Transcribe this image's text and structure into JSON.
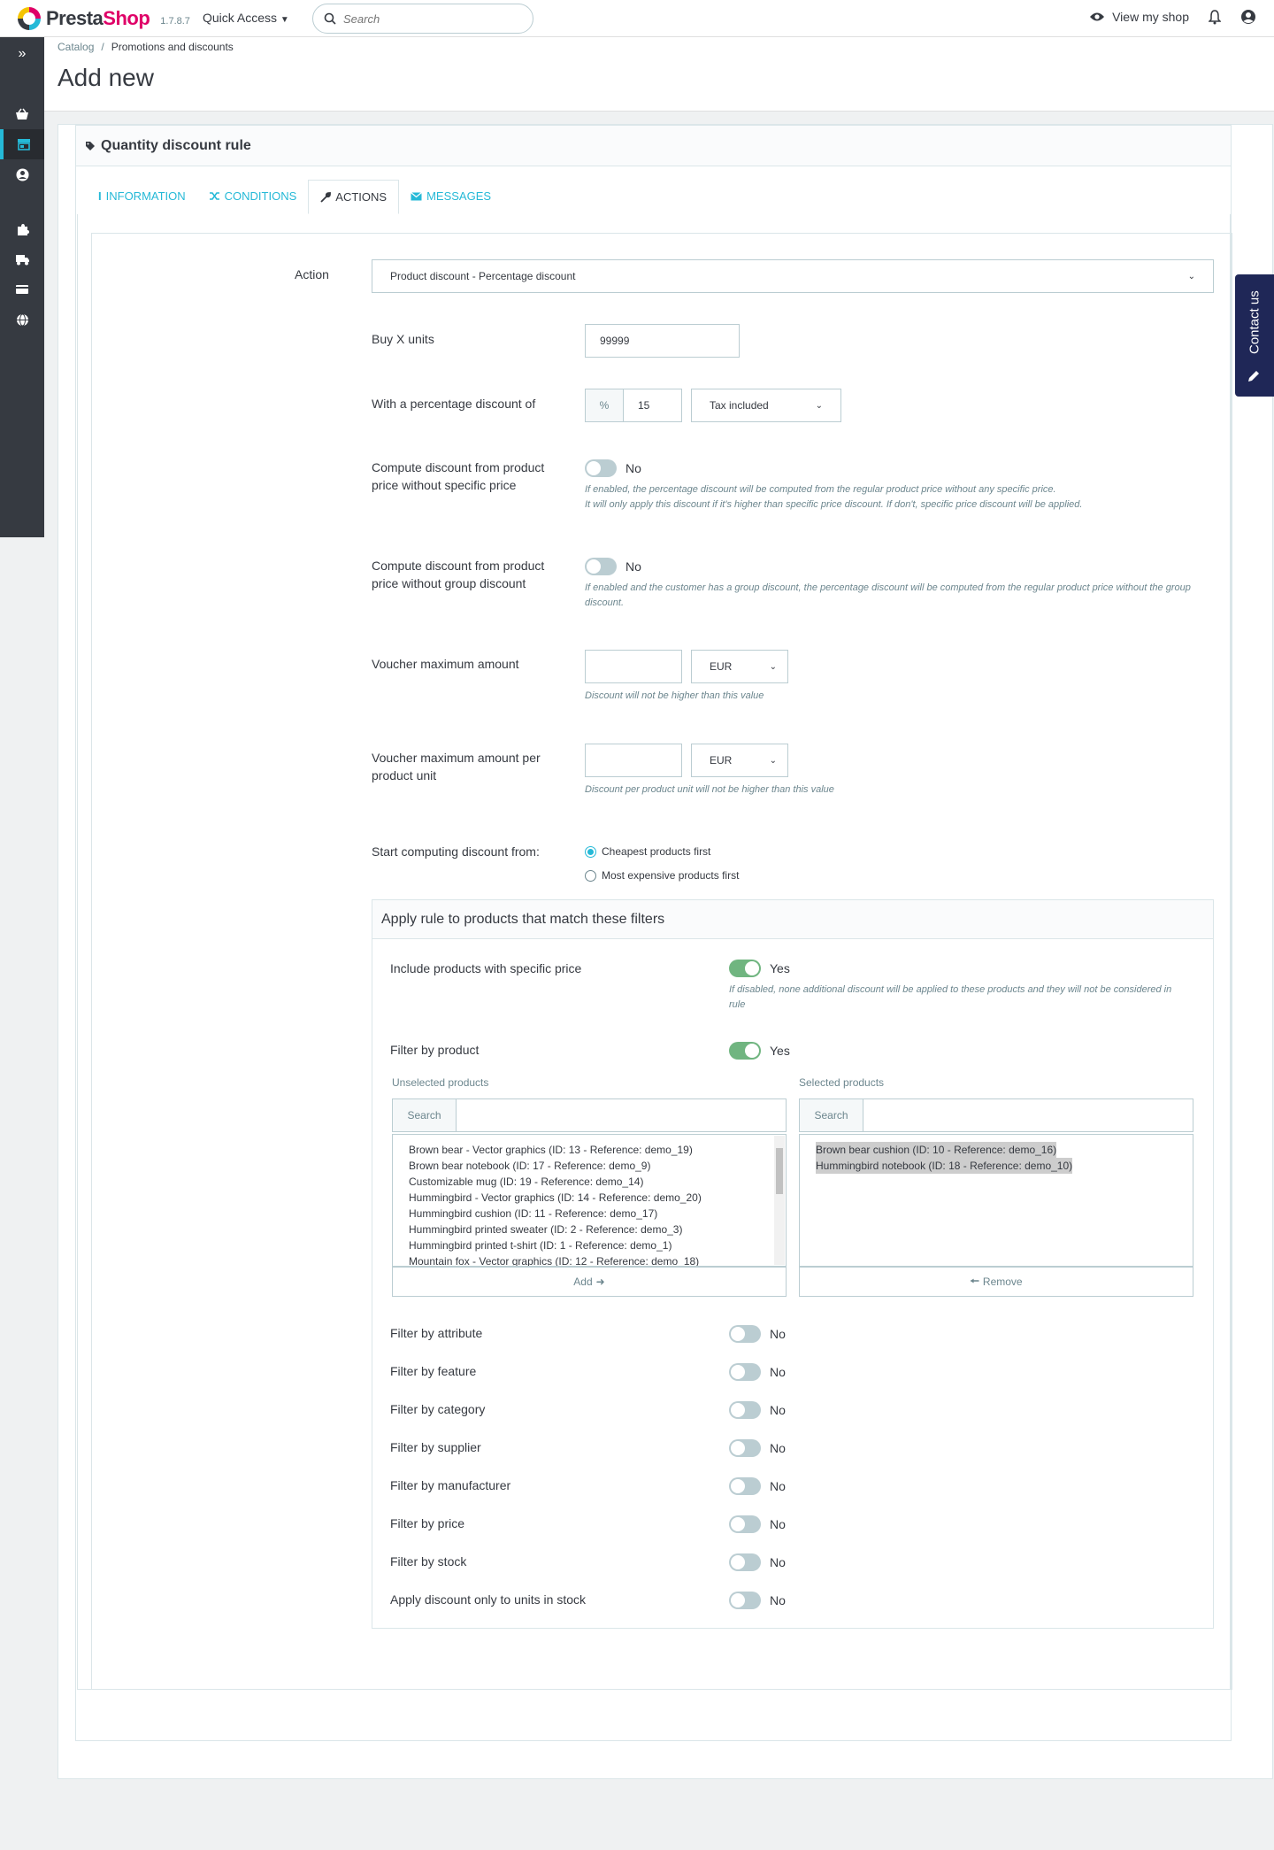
{
  "header": {
    "logo_presta": "Presta",
    "logo_shop": "Shop",
    "version": "1.7.8.7",
    "quick_access": "Quick Access",
    "search_placeholder": "Search",
    "view_my_shop": "View my shop"
  },
  "breadcrumb": {
    "catalog": "Catalog",
    "current": "Promotions and discounts"
  },
  "page_title": "Add new",
  "panel_title": "Quantity discount rule",
  "tabs": [
    {
      "label": "Information"
    },
    {
      "label": "Conditions"
    },
    {
      "label": "Actions"
    },
    {
      "label": "Messages"
    }
  ],
  "form": {
    "action_label": "Action",
    "action_value": "Product discount - Percentage discount",
    "buy_x_label": "Buy X units",
    "buy_x_value": "99999",
    "percent_label": "With a percentage discount of",
    "percent_addon": "%",
    "percent_value": "15",
    "tax_value": "Tax included",
    "compute_specific_label": "Compute discount from product price without specific price",
    "compute_specific_state": "No",
    "compute_specific_help_1": "If enabled, the percentage discount will be computed from the regular product price without any specific price.",
    "compute_specific_help_2": "It will only apply this discount if it's higher than specific price discount. If don't, specific price discount will be applied.",
    "compute_group_label": "Compute discount from product price without group discount",
    "compute_group_state": "No",
    "compute_group_help": "If enabled and the customer has a group discount, the percentage discount will be computed from the regular product price without the group discount.",
    "voucher_max_label": "Voucher maximum amount",
    "voucher_max_value": "",
    "voucher_max_currency": "EUR",
    "voucher_max_help": "Discount will not be higher than this value",
    "voucher_unit_label": "Voucher maximum amount per product unit",
    "voucher_unit_value": "",
    "voucher_unit_currency": "EUR",
    "voucher_unit_help": "Discount per product unit will not be higher than this value",
    "start_label": "Start computing discount from:",
    "start_opt_1": "Cheapest products first",
    "start_opt_2": "Most expensive products first"
  },
  "filters": {
    "title": "Apply rule to products that match these filters",
    "include_specific_label": "Include products with specific price",
    "include_specific_state": "Yes",
    "include_specific_help": "If disabled, none additional discount will be applied to these products and they will not be considered in rule",
    "filter_product_label": "Filter by product",
    "filter_product_state": "Yes",
    "unselected_label": "Unselected products",
    "selected_label": "Selected products",
    "search_addon": "Search",
    "unselected": [
      "Brown bear - Vector graphics (ID: 13 - Reference: demo_19)",
      "Brown bear notebook (ID: 17 - Reference: demo_9)",
      "Customizable mug (ID: 19 - Reference: demo_14)",
      "Hummingbird - Vector graphics (ID: 14 - Reference: demo_20)",
      "Hummingbird cushion (ID: 11 - Reference: demo_17)",
      "Hummingbird printed sweater (ID: 2 - Reference: demo_3)",
      "Hummingbird printed t-shirt (ID: 1 - Reference: demo_1)",
      "Mountain fox - Vector graphics (ID: 12 - Reference: demo_18)"
    ],
    "selected": [
      "Brown bear cushion (ID: 10 - Reference: demo_16)",
      "Hummingbird notebook (ID: 18 - Reference: demo_10)"
    ],
    "add_label": "Add",
    "remove_label": "Remove",
    "toggles": [
      {
        "label": "Filter by attribute",
        "state": "No"
      },
      {
        "label": "Filter by feature",
        "state": "No"
      },
      {
        "label": "Filter by category",
        "state": "No"
      },
      {
        "label": "Filter by supplier",
        "state": "No"
      },
      {
        "label": "Filter by manufacturer",
        "state": "No"
      },
      {
        "label": "Filter by price",
        "state": "No"
      },
      {
        "label": "Filter by stock",
        "state": "No"
      },
      {
        "label": "Apply discount only to units in stock",
        "state": "No"
      }
    ]
  },
  "contact_us": "Contact us",
  "colors": {
    "accent": "#25b9d7",
    "brand_pink": "#df0067",
    "switch_on": "#70b580",
    "sidebar": "#363a41"
  }
}
